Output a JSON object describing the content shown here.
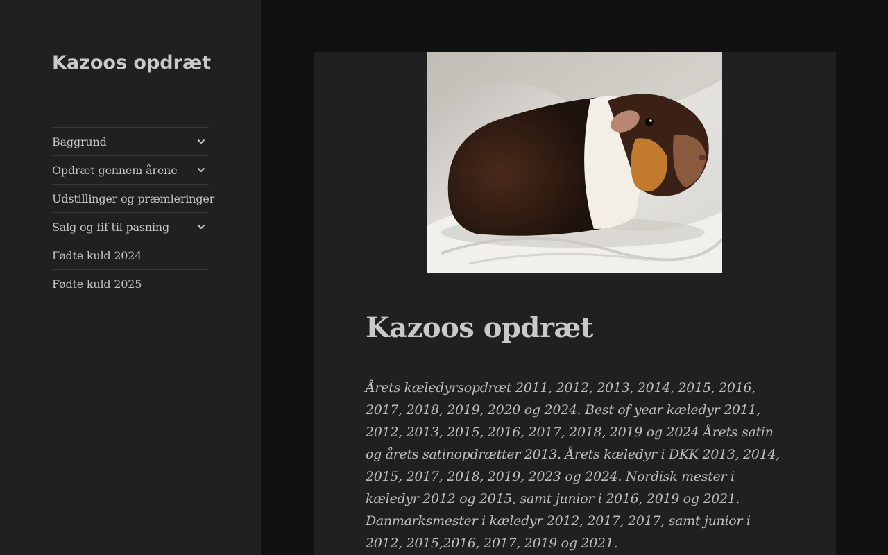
{
  "site": {
    "title": "Kazoos opdræt"
  },
  "nav": {
    "items": [
      {
        "label": "Baggrund",
        "has_submenu": true
      },
      {
        "label": "Opdræt gennem årene",
        "has_submenu": true
      },
      {
        "label": "Udstillinger og præmieringer",
        "has_submenu": false
      },
      {
        "label": "Salg og fif til pasning",
        "has_submenu": true
      },
      {
        "label": "Fødte kuld 2024",
        "has_submenu": false
      },
      {
        "label": "Fødte kuld 2025",
        "has_submenu": false
      }
    ],
    "toggle_icon": "chevron-down-icon"
  },
  "article": {
    "image_subject": "guinea-pig-photo",
    "title": "Kazoos opdræt",
    "body": "Årets kæledyrsopdræt 2011, 2012, 2013, 2014, 2015, 2016, 2017, 2018, 2019, 2020 og 2024. Best of year kæledyr 2011, 2012, 2013, 2015, 2016, 2017, 2018, 2019 og 2024 Årets satin og årets satinopdrætter 2013. Årets kæledyr i DKK 2013, 2014, 2015, 2017, 2018, 2019, 2023 og 2024. Nordisk mester i kæledyr 2012 og 2015, samt junior i 2016, 2019 og 2021. Danmarksmester i kæledyr 2012, 2017, 2017, samt junior i 2012, 2015,2016, 2017, 2019 og 2021."
  },
  "colors": {
    "sidebar_bg": "#202020",
    "page_bg": "#111111",
    "text": "#bebebe",
    "divider": "#363636"
  }
}
